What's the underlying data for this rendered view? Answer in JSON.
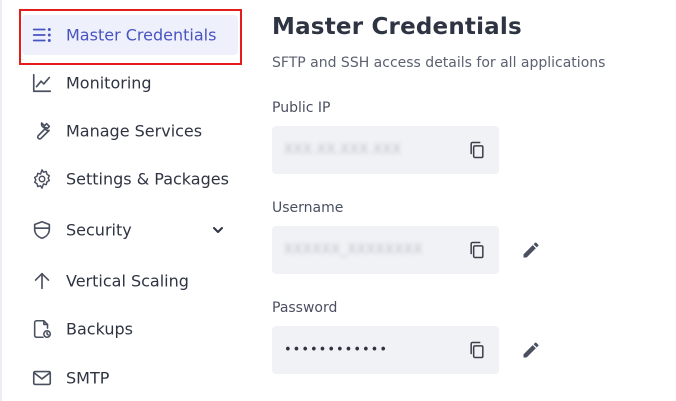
{
  "sidebar": {
    "items": [
      {
        "label": "Master Credentials",
        "icon": "menu-lines-icon",
        "active": true
      },
      {
        "label": "Monitoring",
        "icon": "chart-line-icon"
      },
      {
        "label": "Manage Services",
        "icon": "wrench-icon"
      },
      {
        "label": "Settings & Packages",
        "icon": "gear-icon"
      },
      {
        "label": "Security",
        "icon": "shield-icon",
        "expandable": true
      },
      {
        "label": "Vertical Scaling",
        "icon": "arrow-up-icon"
      },
      {
        "label": "Backups",
        "icon": "backup-icon"
      },
      {
        "label": "SMTP",
        "icon": "mail-icon"
      }
    ]
  },
  "main": {
    "title": "Master Credentials",
    "subtitle": "SFTP and SSH access details for all applications",
    "fields": [
      {
        "label": "Public IP",
        "value": "XXX.XX.XXX.XXX",
        "blurred": true,
        "copy_icon": "copy-icon"
      },
      {
        "label": "Username",
        "value": "XXXXXX_XXXXXXXX",
        "blurred": true,
        "copy_icon": "copy-icon",
        "edit_icon": "pencil-icon"
      },
      {
        "label": "Password",
        "value": "••••••••••••",
        "blurred": false,
        "copy_icon": "copy-icon",
        "edit_icon": "pencil-icon"
      }
    ]
  },
  "colors": {
    "accent": "#4854c1",
    "active_bg": "#eef0fb",
    "highlight_border": "#e41c1c",
    "field_bg": "#f1f2f6",
    "text": "#2e3442",
    "icon": "#4a5060"
  }
}
